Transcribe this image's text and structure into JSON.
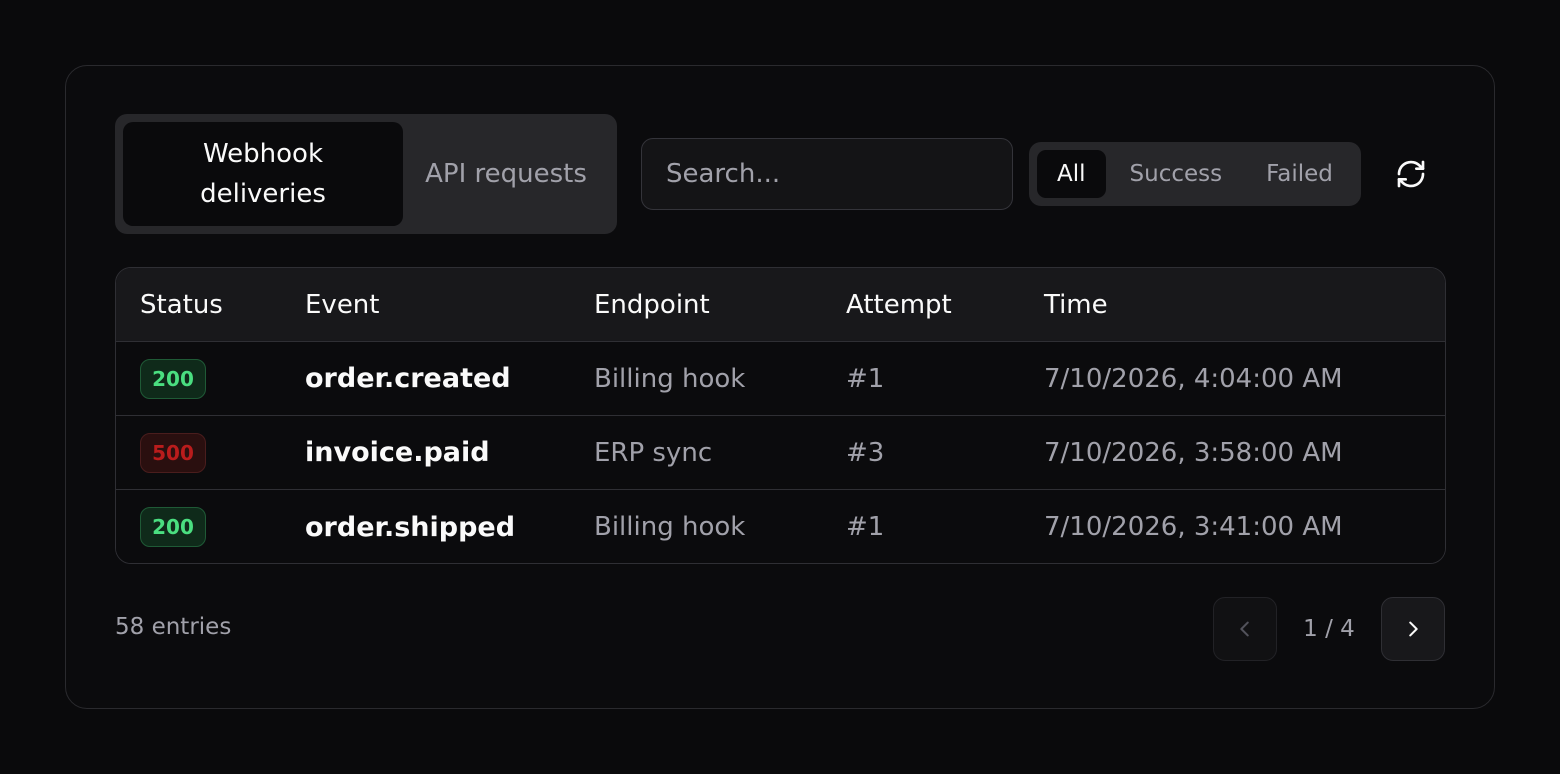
{
  "tabs": [
    {
      "label": "Webhook deliveries",
      "active": true
    },
    {
      "label": "API requests",
      "active": false
    }
  ],
  "search": {
    "placeholder": "Search...",
    "value": ""
  },
  "filters": [
    {
      "label": "All",
      "active": true
    },
    {
      "label": "Success",
      "active": false
    },
    {
      "label": "Failed",
      "active": false
    }
  ],
  "refresh": {
    "icon": "refresh-icon"
  },
  "table": {
    "columns": [
      "Status",
      "Event",
      "Endpoint",
      "Attempt",
      "Time"
    ],
    "rows": [
      {
        "status": "200",
        "status_kind": "success",
        "event": "order.created",
        "endpoint": "Billing hook",
        "attempt": "#1",
        "time": "7/10/2026, 4:04:00 AM"
      },
      {
        "status": "500",
        "status_kind": "error",
        "event": "invoice.paid",
        "endpoint": "ERP sync",
        "attempt": "#3",
        "time": "7/10/2026, 3:58:00 AM"
      },
      {
        "status": "200",
        "status_kind": "success",
        "event": "order.shipped",
        "endpoint": "Billing hook",
        "attempt": "#1",
        "time": "7/10/2026, 3:41:00 AM"
      }
    ]
  },
  "footer": {
    "count": "58 entries",
    "page": "1 / 4"
  },
  "colors": {
    "success_bg": "#0f2a1a",
    "success_border": "#1f5a36",
    "success_text": "#4ade80",
    "error_bg": "#2a0f0f",
    "error_border": "#4a1d1d",
    "error_text": "#b91c1c"
  }
}
